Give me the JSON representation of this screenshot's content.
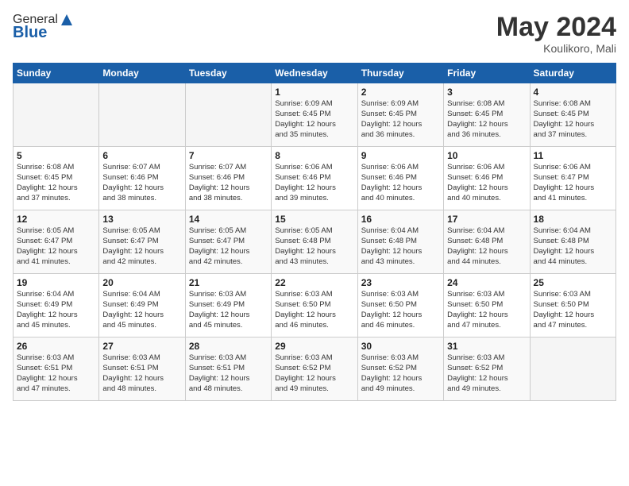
{
  "logo": {
    "general": "General",
    "blue": "Blue"
  },
  "header": {
    "title": "May 2024",
    "subtitle": "Koulikoro, Mali"
  },
  "weekdays": [
    "Sunday",
    "Monday",
    "Tuesday",
    "Wednesday",
    "Thursday",
    "Friday",
    "Saturday"
  ],
  "weeks": [
    [
      {
        "day": "",
        "info": ""
      },
      {
        "day": "",
        "info": ""
      },
      {
        "day": "",
        "info": ""
      },
      {
        "day": "1",
        "info": "Sunrise: 6:09 AM\nSunset: 6:45 PM\nDaylight: 12 hours\nand 35 minutes."
      },
      {
        "day": "2",
        "info": "Sunrise: 6:09 AM\nSunset: 6:45 PM\nDaylight: 12 hours\nand 36 minutes."
      },
      {
        "day": "3",
        "info": "Sunrise: 6:08 AM\nSunset: 6:45 PM\nDaylight: 12 hours\nand 36 minutes."
      },
      {
        "day": "4",
        "info": "Sunrise: 6:08 AM\nSunset: 6:45 PM\nDaylight: 12 hours\nand 37 minutes."
      }
    ],
    [
      {
        "day": "5",
        "info": "Sunrise: 6:08 AM\nSunset: 6:45 PM\nDaylight: 12 hours\nand 37 minutes."
      },
      {
        "day": "6",
        "info": "Sunrise: 6:07 AM\nSunset: 6:46 PM\nDaylight: 12 hours\nand 38 minutes."
      },
      {
        "day": "7",
        "info": "Sunrise: 6:07 AM\nSunset: 6:46 PM\nDaylight: 12 hours\nand 38 minutes."
      },
      {
        "day": "8",
        "info": "Sunrise: 6:06 AM\nSunset: 6:46 PM\nDaylight: 12 hours\nand 39 minutes."
      },
      {
        "day": "9",
        "info": "Sunrise: 6:06 AM\nSunset: 6:46 PM\nDaylight: 12 hours\nand 40 minutes."
      },
      {
        "day": "10",
        "info": "Sunrise: 6:06 AM\nSunset: 6:46 PM\nDaylight: 12 hours\nand 40 minutes."
      },
      {
        "day": "11",
        "info": "Sunrise: 6:06 AM\nSunset: 6:47 PM\nDaylight: 12 hours\nand 41 minutes."
      }
    ],
    [
      {
        "day": "12",
        "info": "Sunrise: 6:05 AM\nSunset: 6:47 PM\nDaylight: 12 hours\nand 41 minutes."
      },
      {
        "day": "13",
        "info": "Sunrise: 6:05 AM\nSunset: 6:47 PM\nDaylight: 12 hours\nand 42 minutes."
      },
      {
        "day": "14",
        "info": "Sunrise: 6:05 AM\nSunset: 6:47 PM\nDaylight: 12 hours\nand 42 minutes."
      },
      {
        "day": "15",
        "info": "Sunrise: 6:05 AM\nSunset: 6:48 PM\nDaylight: 12 hours\nand 43 minutes."
      },
      {
        "day": "16",
        "info": "Sunrise: 6:04 AM\nSunset: 6:48 PM\nDaylight: 12 hours\nand 43 minutes."
      },
      {
        "day": "17",
        "info": "Sunrise: 6:04 AM\nSunset: 6:48 PM\nDaylight: 12 hours\nand 44 minutes."
      },
      {
        "day": "18",
        "info": "Sunrise: 6:04 AM\nSunset: 6:48 PM\nDaylight: 12 hours\nand 44 minutes."
      }
    ],
    [
      {
        "day": "19",
        "info": "Sunrise: 6:04 AM\nSunset: 6:49 PM\nDaylight: 12 hours\nand 45 minutes."
      },
      {
        "day": "20",
        "info": "Sunrise: 6:04 AM\nSunset: 6:49 PM\nDaylight: 12 hours\nand 45 minutes."
      },
      {
        "day": "21",
        "info": "Sunrise: 6:03 AM\nSunset: 6:49 PM\nDaylight: 12 hours\nand 45 minutes."
      },
      {
        "day": "22",
        "info": "Sunrise: 6:03 AM\nSunset: 6:50 PM\nDaylight: 12 hours\nand 46 minutes."
      },
      {
        "day": "23",
        "info": "Sunrise: 6:03 AM\nSunset: 6:50 PM\nDaylight: 12 hours\nand 46 minutes."
      },
      {
        "day": "24",
        "info": "Sunrise: 6:03 AM\nSunset: 6:50 PM\nDaylight: 12 hours\nand 47 minutes."
      },
      {
        "day": "25",
        "info": "Sunrise: 6:03 AM\nSunset: 6:50 PM\nDaylight: 12 hours\nand 47 minutes."
      }
    ],
    [
      {
        "day": "26",
        "info": "Sunrise: 6:03 AM\nSunset: 6:51 PM\nDaylight: 12 hours\nand 47 minutes."
      },
      {
        "day": "27",
        "info": "Sunrise: 6:03 AM\nSunset: 6:51 PM\nDaylight: 12 hours\nand 48 minutes."
      },
      {
        "day": "28",
        "info": "Sunrise: 6:03 AM\nSunset: 6:51 PM\nDaylight: 12 hours\nand 48 minutes."
      },
      {
        "day": "29",
        "info": "Sunrise: 6:03 AM\nSunset: 6:52 PM\nDaylight: 12 hours\nand 49 minutes."
      },
      {
        "day": "30",
        "info": "Sunrise: 6:03 AM\nSunset: 6:52 PM\nDaylight: 12 hours\nand 49 minutes."
      },
      {
        "day": "31",
        "info": "Sunrise: 6:03 AM\nSunset: 6:52 PM\nDaylight: 12 hours\nand 49 minutes."
      },
      {
        "day": "",
        "info": ""
      }
    ]
  ]
}
